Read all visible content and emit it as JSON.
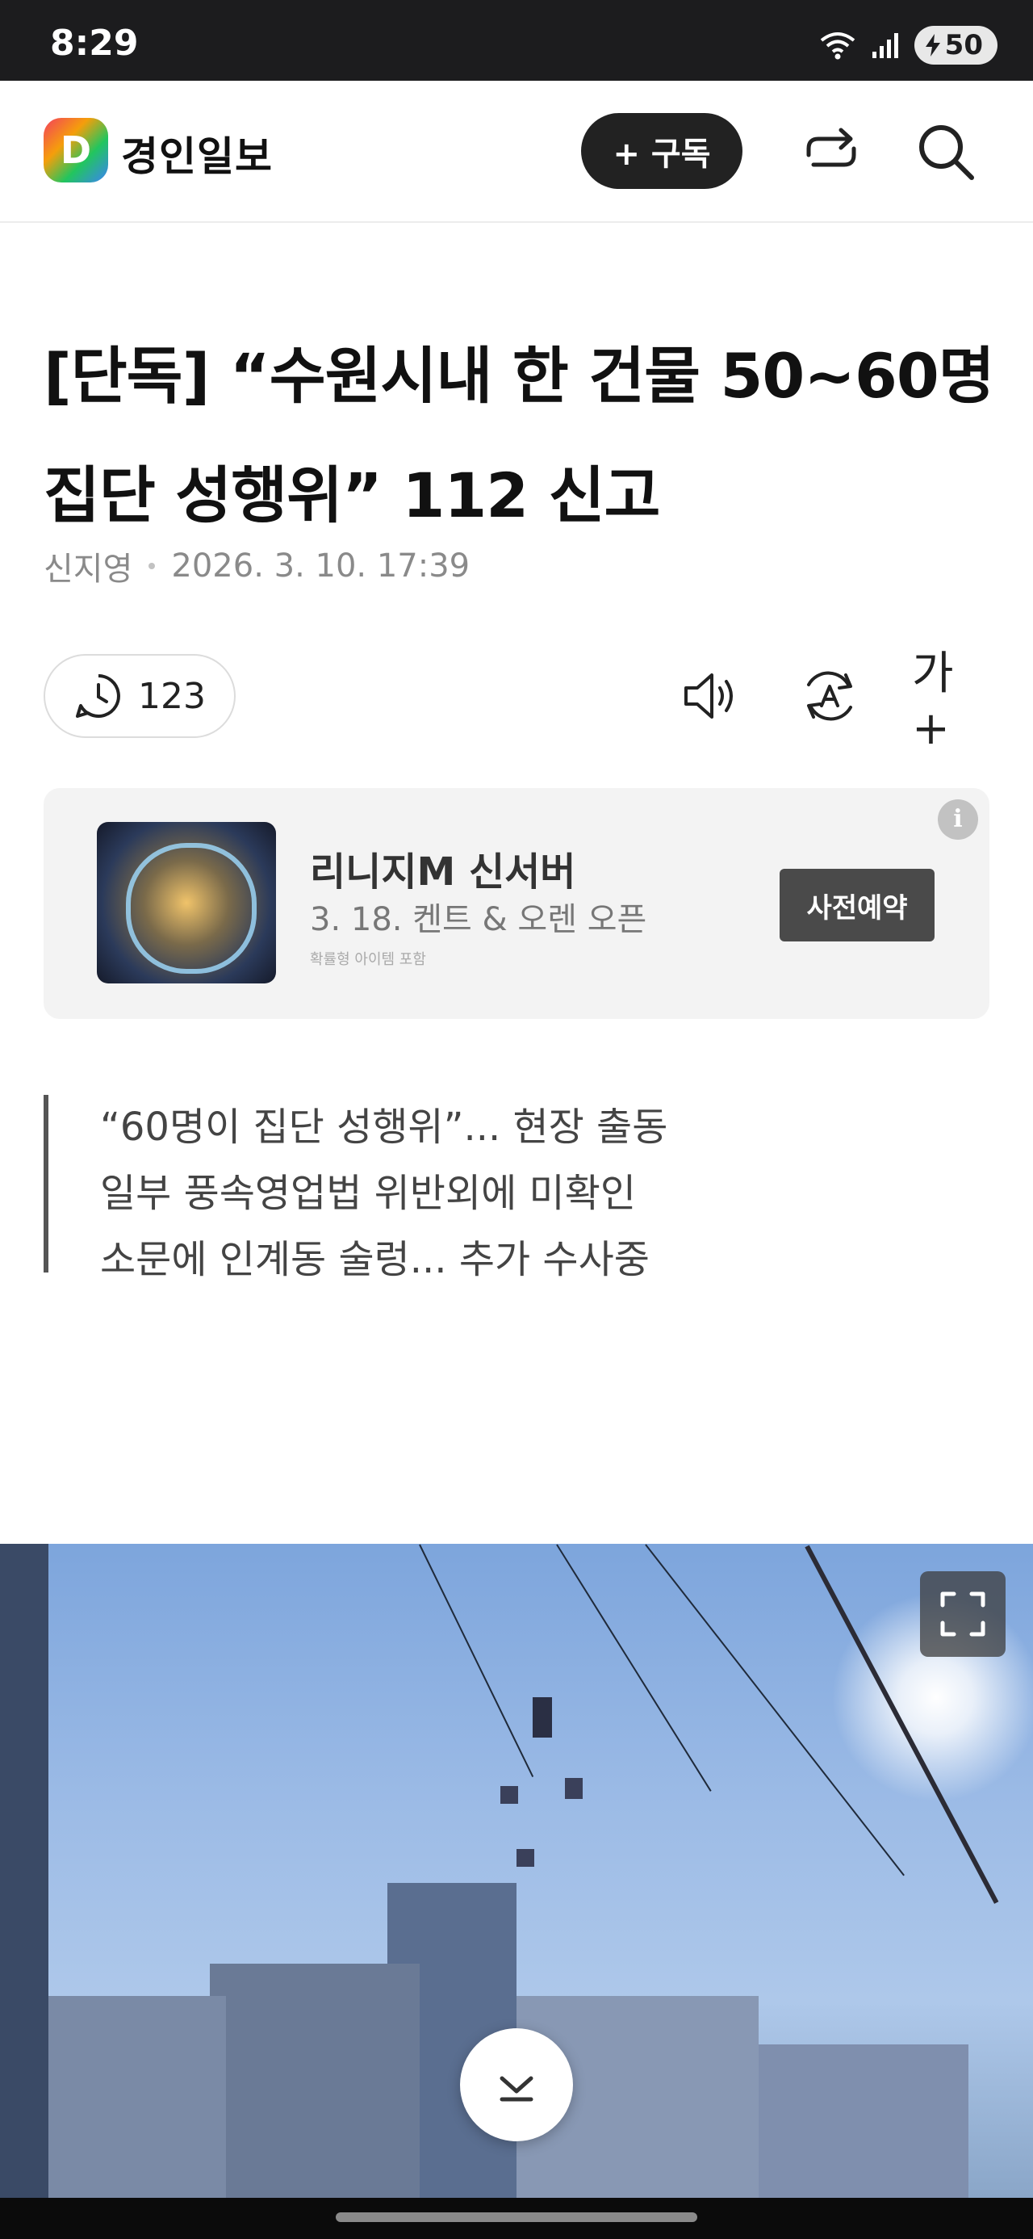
{
  "status_bar": {
    "time": "8:29",
    "battery": "50"
  },
  "header": {
    "logo_letter": "D",
    "brand": "경인일보",
    "subscribe_label": "+ 구독",
    "icons": [
      "share-icon",
      "search-icon"
    ]
  },
  "article": {
    "title": "[단독] “수원시내 한 건물 50~60명 집단 성행위” 112 신고",
    "author": "신지영",
    "date": "2026. 3. 10. 17:39",
    "comment_count": "123",
    "tool_icons": [
      "speaker-icon",
      "translate-icon",
      "font-size-icon"
    ],
    "font_size_label": "가+"
  },
  "ad": {
    "title": "리니지M 신서버",
    "subtitle": "3. 18. 켄트 & 오렌  오픈",
    "note": "확률형 아이템 포함",
    "cta": "사전예약",
    "info_icon": "i"
  },
  "summary": {
    "lines": [
      "“60명이 집단 성행위”... 현장 출동",
      "일부 풍속영업법 위반외에 미확인",
      "소문에 인계동 술렁... 추가 수사중"
    ]
  },
  "colors": {
    "status_bar_bg": "#1c1c1e",
    "subscribe_bg": "#222222",
    "ad_bg": "#f3f3f3",
    "ad_cta_bg": "#4a4a4a",
    "photo_sky": "#7da5dc"
  }
}
